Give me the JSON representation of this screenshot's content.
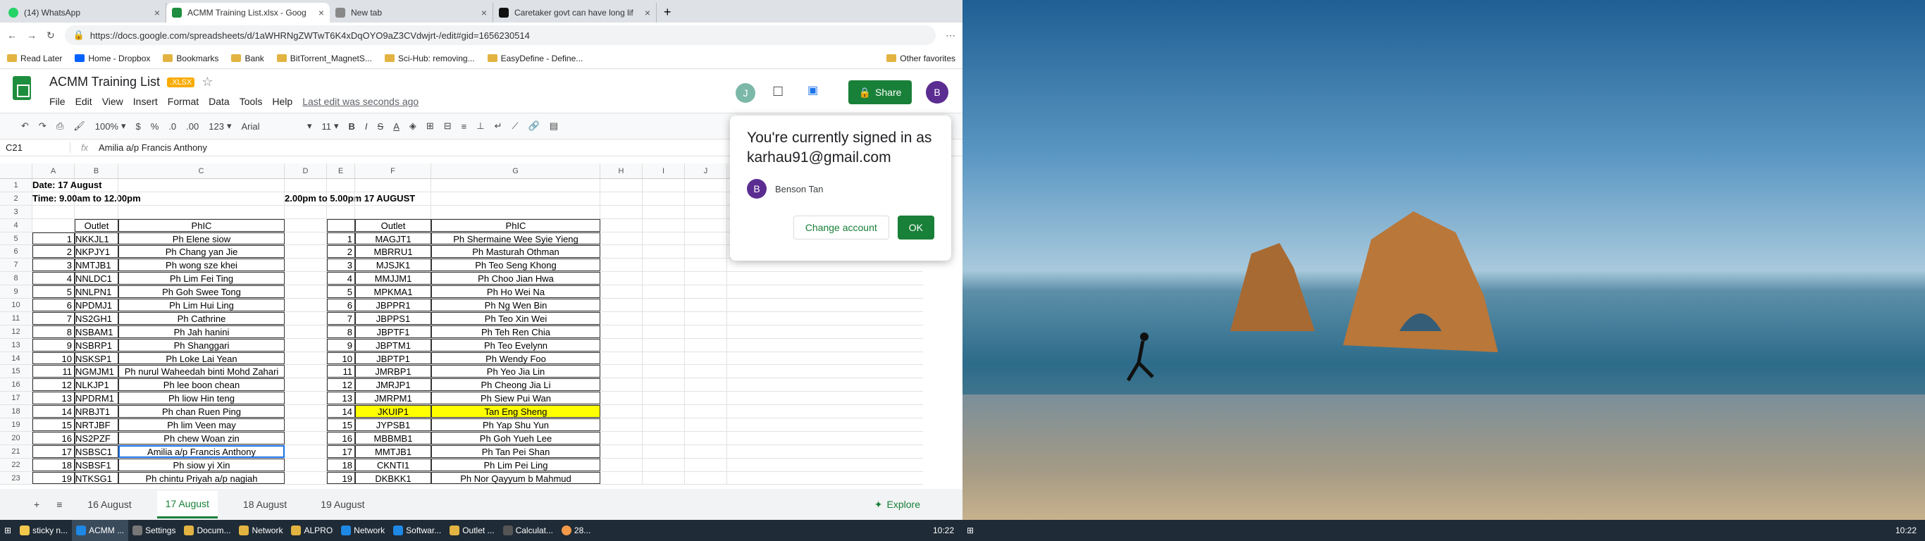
{
  "browser": {
    "tabs": [
      {
        "title": "(14) WhatsApp",
        "active": false
      },
      {
        "title": "ACMM Training List.xlsx - Goog",
        "active": true
      },
      {
        "title": "New tab",
        "active": false
      },
      {
        "title": "Caretaker govt can have long lif",
        "active": false
      }
    ],
    "url": "https://docs.google.com/spreadsheets/d/1aWHRNgZWTwT6K4xDqOYO9aZ3CVdwjrt-/edit#gid=1656230514",
    "bookmarks": [
      "Read Later",
      "Home - Dropbox",
      "Bookmarks",
      "Bank",
      "BitTorrent_MagnetS...",
      "Sci-Hub: removing...",
      "EasyDefine - Define...",
      "Other favorites"
    ]
  },
  "sheets": {
    "title": "ACMM Training List",
    "badge": ".XLSX",
    "menu": [
      "File",
      "Edit",
      "View",
      "Insert",
      "Format",
      "Data",
      "Tools",
      "Help"
    ],
    "last_edit": "Last edit was seconds ago",
    "share_label": "Share",
    "avatar_j": "J",
    "avatar_b": "B",
    "zoom": "100%",
    "font": "Arial",
    "font_size": "11",
    "fmt_currency": "$",
    "fmt_percent": "%",
    "fmt_more": "123",
    "cell_ref": "C21",
    "formula": "Amilia a/p Francis Anthony",
    "columns": [
      "A",
      "B",
      "C",
      "D",
      "E",
      "F",
      "G",
      "H",
      "I",
      "J"
    ],
    "explore": "Explore",
    "sheet_tabs": [
      "16 August",
      "17 August",
      "18 August",
      "19 August"
    ],
    "active_sheet": "17 August"
  },
  "grid": {
    "date": "Date: 17 August",
    "time_left": "Time: 9.00am to 12.00pm",
    "time_right": "2.00pm to 5.00pm 17 AUGUST",
    "hdr_outlet": "Outlet",
    "hdr_phic": "PhIC",
    "left": [
      [
        "1",
        "NKKJL1",
        "Ph Elene siow"
      ],
      [
        "2",
        "NKPJY1",
        "Ph Chang yan Jie"
      ],
      [
        "3",
        "NMTJB1",
        "Ph wong sze khei"
      ],
      [
        "4",
        "NNLDC1",
        "Ph Lim Fei Ting"
      ],
      [
        "5",
        "NNLPN1",
        "Ph Goh Swee Tong"
      ],
      [
        "6",
        "NPDMJ1",
        "Ph Lim Hui Ling"
      ],
      [
        "7",
        "NS2GH1",
        "Ph Cathrine"
      ],
      [
        "8",
        "NSBAM1",
        "Ph Jah hanini"
      ],
      [
        "9",
        "NSBRP1",
        "Ph Shanggari"
      ],
      [
        "10",
        "NSKSP1",
        "Ph Loke Lai Yean"
      ],
      [
        "11",
        "NGMJM1",
        "Ph nurul Waheedah binti Mohd Zahari"
      ],
      [
        "12",
        "NLKJP1",
        "Ph lee boon chean"
      ],
      [
        "13",
        "NPDRM1",
        "Ph liow Hin teng"
      ],
      [
        "14",
        "NRBJT1",
        "Ph chan Ruen Ping"
      ],
      [
        "15",
        "NRTJBF",
        "Ph lim Veen may"
      ],
      [
        "16",
        "NS2PZF",
        "Ph chew Woan zin"
      ],
      [
        "17",
        "NSBSC1",
        "Amilia a/p Francis Anthony"
      ],
      [
        "18",
        "NSBSF1",
        "Ph siow yi Xin"
      ],
      [
        "19",
        "NTKSG1",
        "Ph chintu Priyah a/p nagiah"
      ]
    ],
    "right": [
      [
        "1",
        "MAGJT1",
        "Ph Shermaine Wee Syie Yieng"
      ],
      [
        "2",
        "MBRRU1",
        "Ph Masturah Othman"
      ],
      [
        "3",
        "MJSJK1",
        "Ph Teo Seng Khong"
      ],
      [
        "4",
        "MMJJM1",
        "Ph Choo Jian Hwa"
      ],
      [
        "5",
        "MPKMA1",
        "Ph Ho Wei Na"
      ],
      [
        "6",
        "JBPPR1",
        "Ph Ng Wen Bin"
      ],
      [
        "7",
        "JBPPS1",
        "Ph Teo Xin Wei"
      ],
      [
        "8",
        "JBPTF1",
        "Ph Teh Ren Chia"
      ],
      [
        "9",
        "JBPTM1",
        "Ph Teo Evelynn"
      ],
      [
        "10",
        "JBPTP1",
        "Ph Wendy Foo"
      ],
      [
        "11",
        "JMRBP1",
        "Ph Yeo Jia Lin"
      ],
      [
        "12",
        "JMRJP1",
        "Ph Cheong Jia Li"
      ],
      [
        "13",
        "JMRPM1",
        "Ph Siew Pui Wan"
      ],
      [
        "14",
        "JKUIP1",
        "Tan Eng Sheng"
      ],
      [
        "15",
        "JYPSB1",
        "Ph Yap Shu Yun"
      ],
      [
        "16",
        "MBBMB1",
        "Ph Goh Yueh Lee"
      ],
      [
        "17",
        "MMTJB1",
        "Ph Tan Pei Shan"
      ],
      [
        "18",
        "CKNTI1",
        "Ph Lim Pei Ling"
      ],
      [
        "19",
        "DKBKK1",
        "Ph Nor Qayyum b Mahmud"
      ]
    ]
  },
  "popup": {
    "message": "You're currently signed in as karhau91@gmail.com",
    "user_initial": "B",
    "user_name": "Benson Tan",
    "change_label": "Change account",
    "ok_label": "OK"
  },
  "taskbar_left": [
    "sticky n...",
    "ACMM ...",
    "Settings",
    "Docum...",
    "Network",
    "ALPRO",
    "Network",
    "Softwar...",
    "Outlet ...",
    "Calculat..."
  ],
  "weather": "28...",
  "clock": "10:22",
  "clock_right": "10:22",
  "colors": {
    "green": "#188038",
    "highlight": "#ffff00",
    "select": "#1a73e8"
  }
}
